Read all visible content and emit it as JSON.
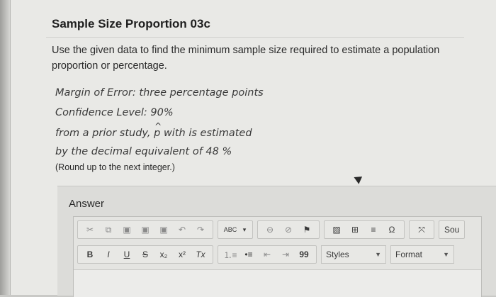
{
  "question": {
    "title": "Sample Size Proportion 03c",
    "prompt": "Use the given data to find the minimum sample size required to estimate a population proportion or percentage.",
    "margin_of_error": "Margin of Error: three percentage points",
    "confidence_level": "Confidence Level: 90%",
    "prior_study_prefix": "from a prior study,",
    "p_symbol": "p",
    "hat_symbol": "^",
    "prior_study_suffix": "with is estimated",
    "decimal_line": "by the decimal equivalent of 48 %",
    "note": "(Round up to the next integer.)"
  },
  "answer": {
    "label": "Answer",
    "toolbar1": {
      "cut": "✂",
      "copy": "⧉",
      "paste": "▣",
      "paste_text": "▣",
      "paste_word": "▣",
      "undo": "↶",
      "redo": "↷",
      "spellcheck": "ABC",
      "spell_caret": "▾",
      "link": "⊖",
      "unlink": "⊘",
      "anchor": "⚑",
      "image": "▨",
      "table": "⊞",
      "hr": "≡",
      "special_char": "Ω",
      "maximize": "⤧",
      "source": "Sou"
    },
    "toolbar2": {
      "bold": "B",
      "italic": "I",
      "underline": "U",
      "strike": "S",
      "subscript": "x₂",
      "superscript": "x²",
      "remove_format": "Tx",
      "numbered_list": "⒈≡",
      "bullet_list": "•≡",
      "outdent": "⇤",
      "indent": "⇥",
      "blockquote": "99",
      "styles": "Styles",
      "format": "Format"
    }
  }
}
